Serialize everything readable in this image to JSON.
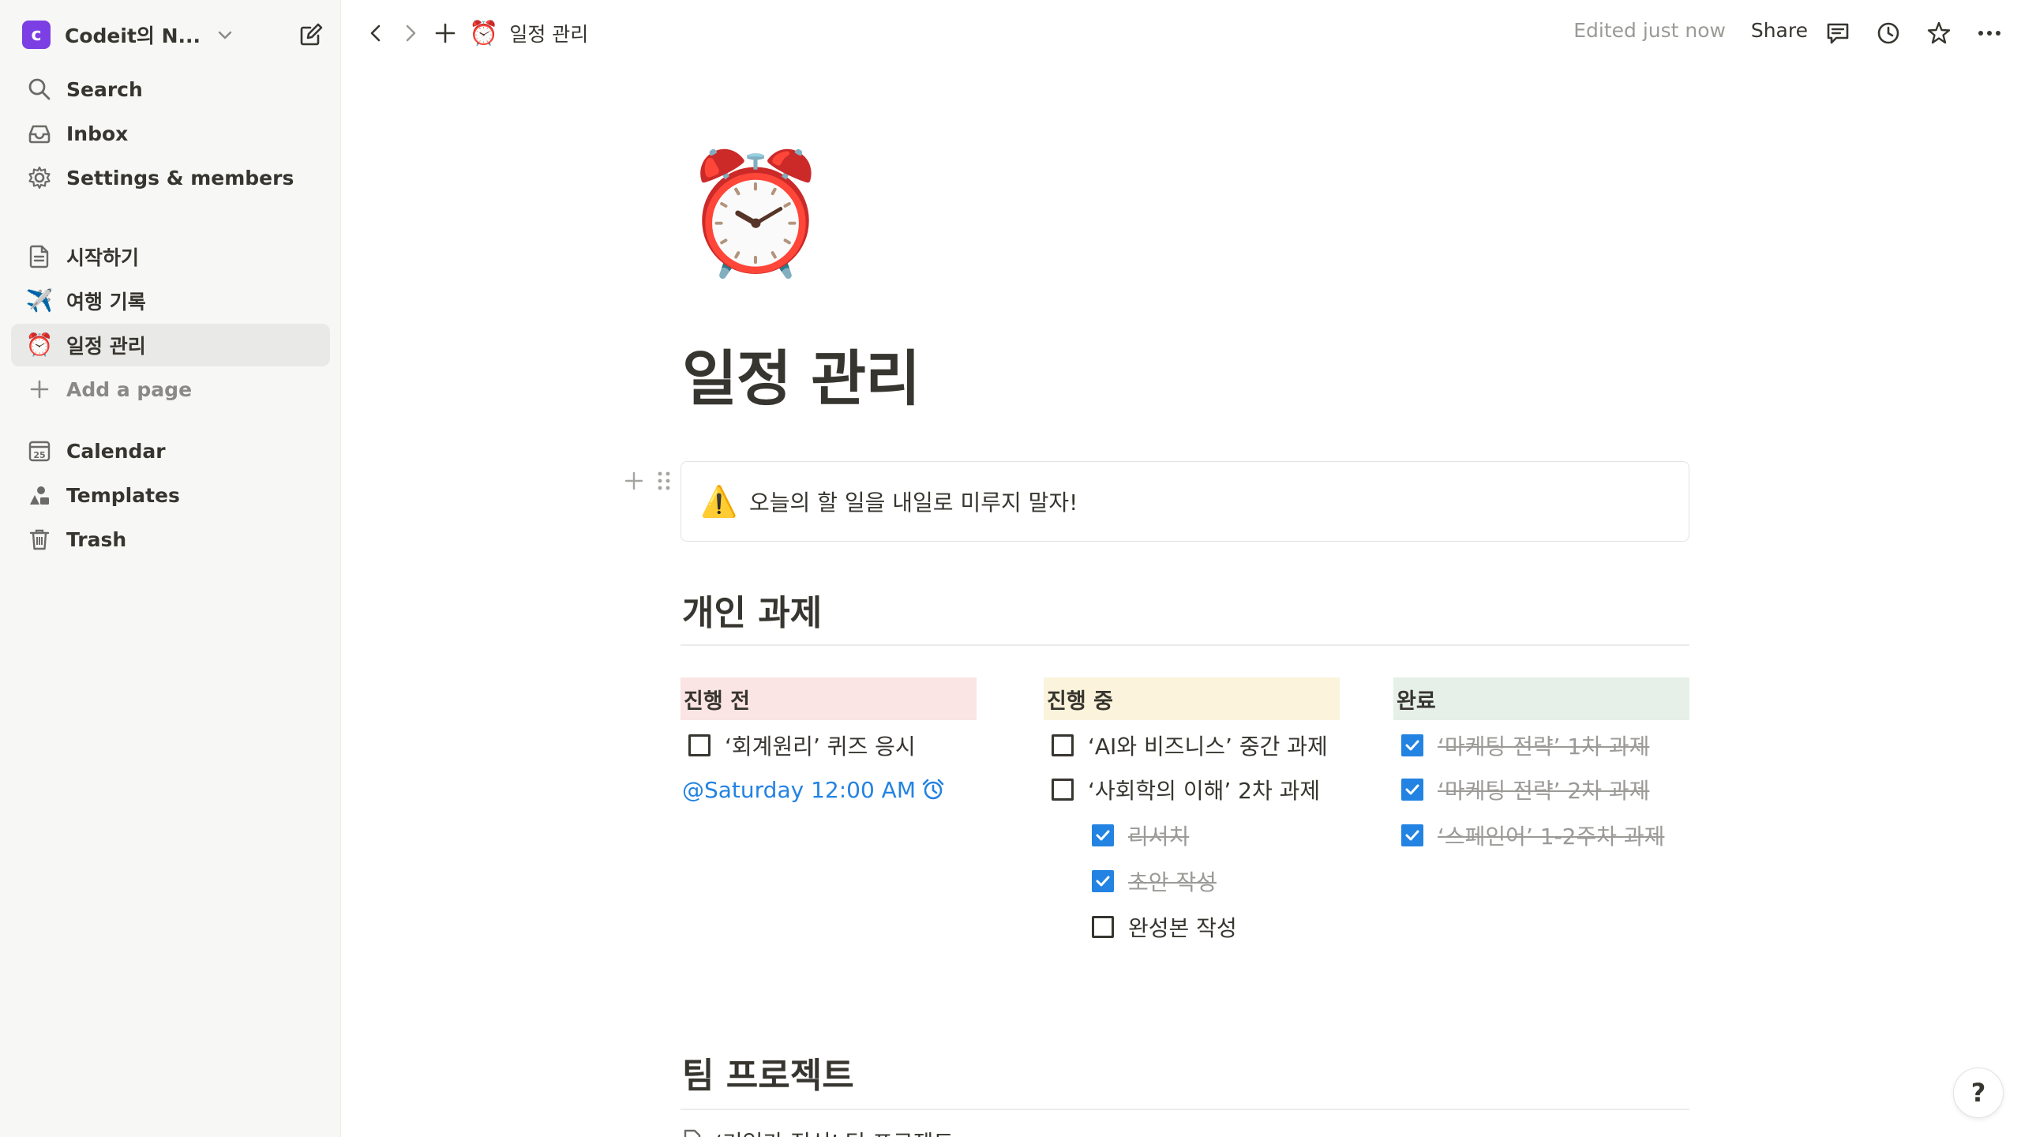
{
  "workspace": {
    "logo_letter": "c",
    "name": "Codeit의 N...",
    "logo_color": "#7b3fe4"
  },
  "sidebar": {
    "top_items": [
      {
        "label": "Search",
        "icon": "search-icon"
      },
      {
        "label": "Inbox",
        "icon": "inbox-icon"
      },
      {
        "label": "Settings & members",
        "icon": "gear-icon"
      }
    ],
    "pages": [
      {
        "label": "시작하기",
        "icon": "page-icon"
      },
      {
        "label": "여행 기록",
        "icon": "airplane-emoji",
        "emoji": "✈️"
      },
      {
        "label": "일정 관리",
        "icon": "alarm-clock-emoji",
        "emoji": "⏰",
        "active": true
      },
      {
        "label": "Add a page",
        "icon": "plus-icon"
      }
    ],
    "bottom_items": [
      {
        "label": "Calendar",
        "icon": "calendar-icon",
        "calendar_day": "25"
      },
      {
        "label": "Templates",
        "icon": "templates-icon"
      },
      {
        "label": "Trash",
        "icon": "trash-icon"
      }
    ]
  },
  "topbar": {
    "breadcrumb_emoji": "⏰",
    "breadcrumb_label": "일정 관리",
    "edited": "Edited just now",
    "share": "Share"
  },
  "page": {
    "icon": "⏰",
    "title": "일정 관리",
    "callout": {
      "icon": "⚠️",
      "text": "오늘의 할 일을 내일로 미루지 말자!"
    },
    "section1_heading": "개인 과제",
    "columns": [
      {
        "title": "진행 전",
        "color": "#fbe4e4"
      },
      {
        "title": "진행 중",
        "color": "#fbf3db"
      },
      {
        "title": "완료",
        "color": "#e6efe8"
      }
    ],
    "todo_before": {
      "text": "‘회계원리’ 퀴즈 응시",
      "checked": false
    },
    "mention": "@Saturday 12:00 AM",
    "todos_progress": [
      {
        "text": "‘AI와 비즈니스’ 중간 과제",
        "checked": false
      },
      {
        "text": "‘사회학의 이해’ 2차 과제",
        "checked": false
      },
      {
        "text": "리서치",
        "checked": true
      },
      {
        "text": "초안 작성",
        "checked": true
      },
      {
        "text": "완성본 작성",
        "checked": false
      }
    ],
    "todos_done": [
      {
        "text": "‘마케팅 전략’ 1차 과제",
        "checked": true
      },
      {
        "text": "‘마케팅 전략’ 2차 과제",
        "checked": true
      },
      {
        "text": "‘스페인어’ 1-2주차 과제",
        "checked": true
      }
    ],
    "section2_heading": "팀 프로젝트",
    "subpage_label": "‘기업가 정신’ 팀 프로젝트"
  },
  "help_label": "?",
  "colors": {
    "accent_blue": "#2383e2",
    "sidebar_bg": "#f7f7f5",
    "text": "#37352f",
    "muted": "#9b9a97"
  }
}
